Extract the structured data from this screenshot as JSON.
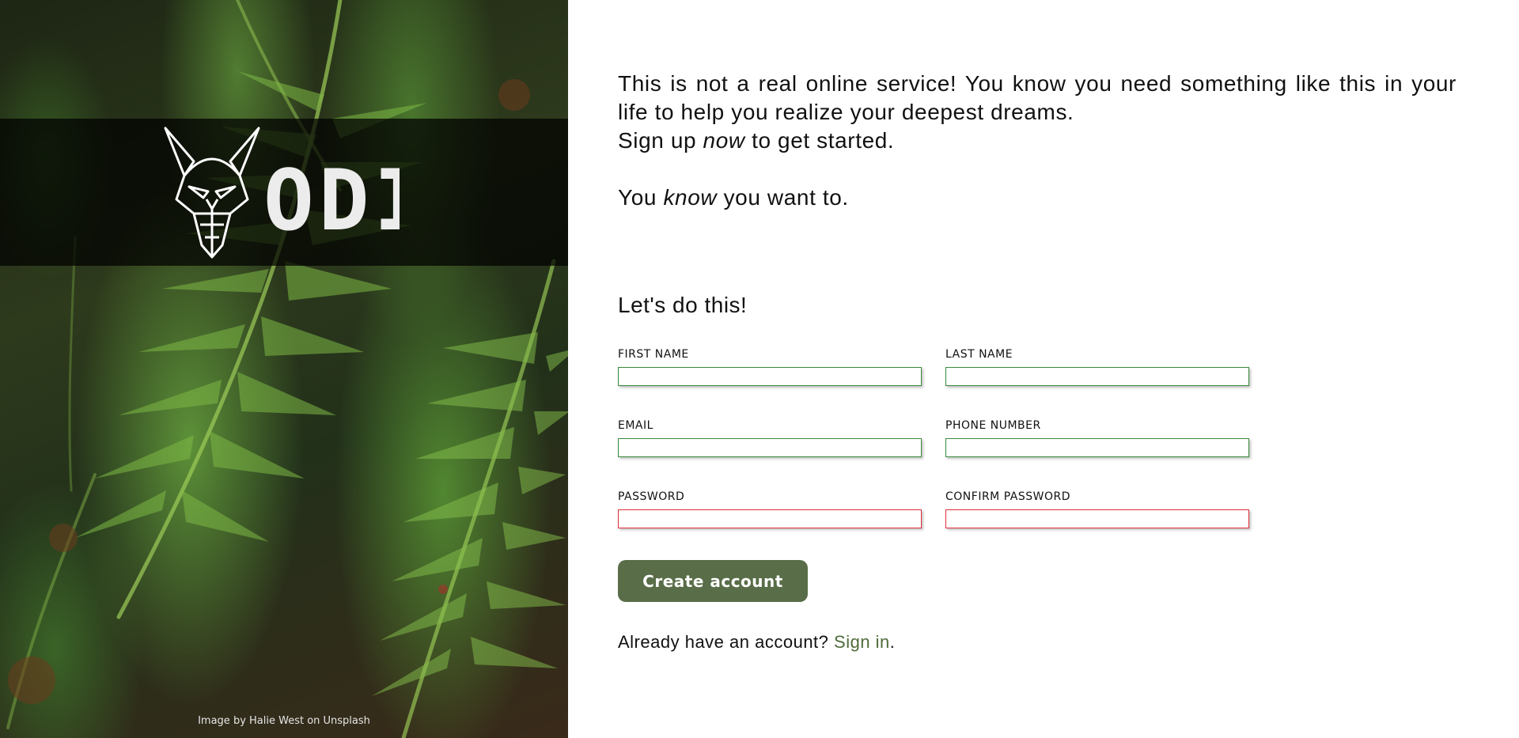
{
  "hero": {
    "logo_text": "ODIN",
    "photo_credit": "Image by Halie West on Unsplash"
  },
  "intro": {
    "line1": "This is not a real online service! You know you need something like this in your life to help you realize your deepest dreams.",
    "line2_before": "Sign up ",
    "line2_emphasis": "now",
    "line2_after": " to get started.",
    "line3_before": "You ",
    "line3_emphasis": "know",
    "line3_after": " you want to."
  },
  "form": {
    "heading": "Let's do this!",
    "fields": {
      "first_name": {
        "label": "FIRST NAME",
        "value": "",
        "state": "valid"
      },
      "last_name": {
        "label": "LAST NAME",
        "value": "",
        "state": "valid"
      },
      "email": {
        "label": "EMAIL",
        "value": "",
        "state": "valid"
      },
      "phone": {
        "label": "PHONE NUMBER",
        "value": "",
        "state": "valid"
      },
      "password": {
        "label": "PASSWORD",
        "value": "",
        "state": "invalid"
      },
      "confirm_password": {
        "label": "CONFIRM PASSWORD",
        "value": "",
        "state": "invalid"
      }
    },
    "submit_label": "Create account"
  },
  "signin": {
    "prompt": "Already have an account? ",
    "link_label": "Sign in",
    "suffix": "."
  },
  "colors": {
    "button_bg": "#596d48",
    "link": "#4f6b3a",
    "valid_border": "#3c8a3c",
    "invalid_border": "#e0303a"
  }
}
